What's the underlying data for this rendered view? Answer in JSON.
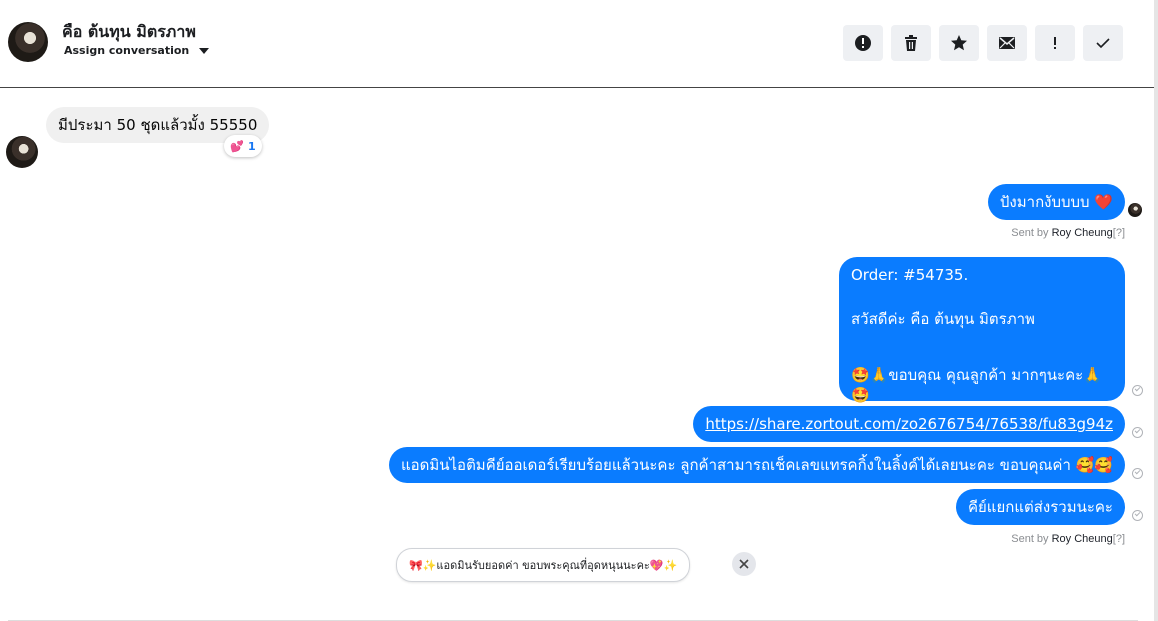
{
  "header": {
    "contact_name": "คือ ต้นทุน มิตรภาพ",
    "assign_label": "Assign conversation",
    "actions": [
      "spam-icon",
      "trash-icon",
      "star-icon",
      "mail-icon",
      "important-icon",
      "done-icon"
    ]
  },
  "messages": {
    "incoming_1": {
      "text": "มีประมา 50 ชุดแล้วมั้ง 55550",
      "reaction_emoji": "💕",
      "reaction_count": "1"
    },
    "outgoing_1": {
      "text": "ปังมากงับบบบ ❤️"
    },
    "sent_by_1": {
      "prefix": "Sent by ",
      "name": "Roy Cheung",
      "suffix": "[?]"
    },
    "order": {
      "line1": "Order: #54735.",
      "line2": "สวัสดีค่ะ คือ ต้นทุน มิตรภาพ",
      "line3": "🤩🙏ขอบคุณ คุณลูกค้า มากๆนะคะ🙏🤩"
    },
    "link": {
      "text": "https://share.zortout.com/zo2676754/76538/fu83g94z"
    },
    "tracking": {
      "text": "แอดมินไอติมคีย์ออเดอร์เรียบร้อยแล้วนะคะ ลูกค้าสามารถเช็คเลขแทรคกิ้งในลิ้งค์ได้เลยนะคะ ขอบคุณค่า 🥰🥰"
    },
    "separate": {
      "text": "คีย์แยกแต่ส่งรวมนะคะ"
    },
    "sent_by_2": {
      "prefix": "Sent by ",
      "name": "Roy Cheung",
      "suffix": "[?]"
    }
  },
  "suggestion": {
    "text": "🎀✨แอดมินรับยอดค่า ขอบพระคุณที่อุดหนุนนะคะ💖✨"
  },
  "colors": {
    "outgoing": "#0a7cff",
    "incoming": "#f0f0f0"
  }
}
